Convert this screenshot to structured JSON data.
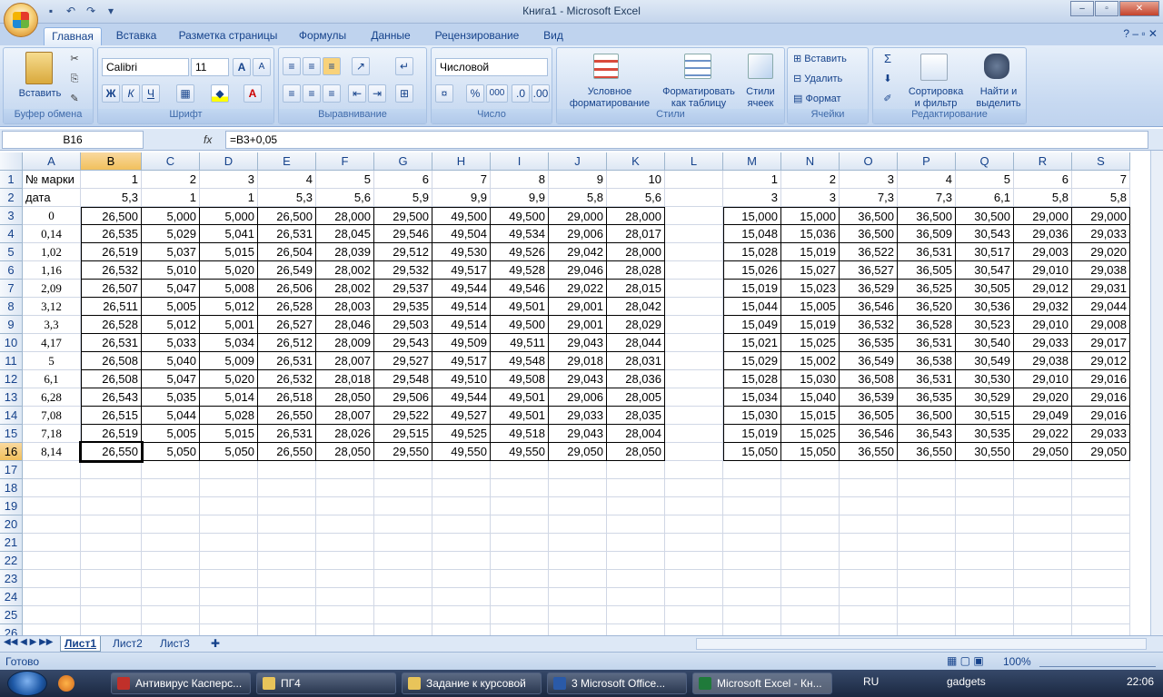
{
  "window": {
    "title": "Книга1 - Microsoft Excel",
    "btn_min": "–",
    "btn_max": "▫",
    "btn_close": "✕"
  },
  "ribbon_tabs": [
    "Главная",
    "Вставка",
    "Разметка страницы",
    "Формулы",
    "Данные",
    "Рецензирование",
    "Вид"
  ],
  "ribbon": {
    "clipboard": {
      "label": "Буфер обмена",
      "paste": "Вставить"
    },
    "font": {
      "label": "Шрифт",
      "name": "Calibri",
      "size": "11",
      "bold": "Ж",
      "italic": "К",
      "underline": "Ч"
    },
    "alignment": {
      "label": "Выравнивание"
    },
    "number": {
      "label": "Число",
      "format": "Числовой",
      "percent": "%",
      "thousands": "000"
    },
    "styles": {
      "label": "Стили",
      "cond1": "Условное",
      "cond2": "форматирование",
      "table1": "Форматировать",
      "table2": "как таблицу",
      "cell1": "Стили",
      "cell2": "ячеек"
    },
    "cells": {
      "label": "Ячейки",
      "insert": "Вставить",
      "delete": "Удалить",
      "format": "Формат"
    },
    "editing": {
      "label": "Редактирование",
      "sort1": "Сортировка",
      "sort2": "и фильтр",
      "find1": "Найти и",
      "find2": "выделить",
      "sigma": "Σ"
    }
  },
  "formula_bar": {
    "name_box": "B16",
    "fx": "fx",
    "formula": "=B3+0,05"
  },
  "columns": [
    "A",
    "B",
    "C",
    "D",
    "E",
    "F",
    "G",
    "H",
    "I",
    "J",
    "K",
    "L",
    "M",
    "N",
    "O",
    "P",
    "Q",
    "R",
    "S"
  ],
  "rows": [
    [
      "№ марки",
      "1",
      "2",
      "3",
      "4",
      "5",
      "6",
      "7",
      "8",
      "9",
      "10",
      "",
      "1",
      "2",
      "3",
      "4",
      "5",
      "6",
      "7"
    ],
    [
      "дата",
      "5,3",
      "1",
      "1",
      "5,3",
      "5,6",
      "5,9",
      "9,9",
      "9,9",
      "5,8",
      "5,6",
      "",
      "3",
      "3",
      "7,3",
      "7,3",
      "6,1",
      "5,8",
      "5,8"
    ],
    [
      "0",
      "26,500",
      "5,000",
      "5,000",
      "26,500",
      "28,000",
      "29,500",
      "49,500",
      "49,500",
      "29,000",
      "28,000",
      "",
      "15,000",
      "15,000",
      "36,500",
      "36,500",
      "30,500",
      "29,000",
      "29,000"
    ],
    [
      "0,14",
      "26,535",
      "5,029",
      "5,041",
      "26,531",
      "28,045",
      "29,546",
      "49,504",
      "49,534",
      "29,006",
      "28,017",
      "",
      "15,048",
      "15,036",
      "36,500",
      "36,509",
      "30,543",
      "29,036",
      "29,033"
    ],
    [
      "1,02",
      "26,519",
      "5,037",
      "5,015",
      "26,504",
      "28,039",
      "29,512",
      "49,530",
      "49,526",
      "29,042",
      "28,000",
      "",
      "15,028",
      "15,019",
      "36,522",
      "36,531",
      "30,517",
      "29,003",
      "29,020"
    ],
    [
      "1,16",
      "26,532",
      "5,010",
      "5,020",
      "26,549",
      "28,002",
      "29,532",
      "49,517",
      "49,528",
      "29,046",
      "28,028",
      "",
      "15,026",
      "15,027",
      "36,527",
      "36,505",
      "30,547",
      "29,010",
      "29,038"
    ],
    [
      "2,09",
      "26,507",
      "5,047",
      "5,008",
      "26,506",
      "28,002",
      "29,537",
      "49,544",
      "49,546",
      "29,022",
      "28,015",
      "",
      "15,019",
      "15,023",
      "36,529",
      "36,525",
      "30,505",
      "29,012",
      "29,031"
    ],
    [
      "3,12",
      "26,511",
      "5,005",
      "5,012",
      "26,528",
      "28,003",
      "29,535",
      "49,514",
      "49,501",
      "29,001",
      "28,042",
      "",
      "15,044",
      "15,005",
      "36,546",
      "36,520",
      "30,536",
      "29,032",
      "29,044"
    ],
    [
      "3,3",
      "26,528",
      "5,012",
      "5,001",
      "26,527",
      "28,046",
      "29,503",
      "49,514",
      "49,500",
      "29,001",
      "28,029",
      "",
      "15,049",
      "15,019",
      "36,532",
      "36,528",
      "30,523",
      "29,010",
      "29,008"
    ],
    [
      "4,17",
      "26,531",
      "5,033",
      "5,034",
      "26,512",
      "28,009",
      "29,543",
      "49,509",
      "49,511",
      "29,043",
      "28,044",
      "",
      "15,021",
      "15,025",
      "36,535",
      "36,531",
      "30,540",
      "29,033",
      "29,017"
    ],
    [
      "5",
      "26,508",
      "5,040",
      "5,009",
      "26,531",
      "28,007",
      "29,527",
      "49,517",
      "49,548",
      "29,018",
      "28,031",
      "",
      "15,029",
      "15,002",
      "36,549",
      "36,538",
      "30,549",
      "29,038",
      "29,012"
    ],
    [
      "6,1",
      "26,508",
      "5,047",
      "5,020",
      "26,532",
      "28,018",
      "29,548",
      "49,510",
      "49,508",
      "29,043",
      "28,036",
      "",
      "15,028",
      "15,030",
      "36,508",
      "36,531",
      "30,530",
      "29,010",
      "29,016"
    ],
    [
      "6,28",
      "26,543",
      "5,035",
      "5,014",
      "26,518",
      "28,050",
      "29,506",
      "49,544",
      "49,501",
      "29,006",
      "28,005",
      "",
      "15,034",
      "15,040",
      "36,539",
      "36,535",
      "30,529",
      "29,020",
      "29,016"
    ],
    [
      "7,08",
      "26,515",
      "5,044",
      "5,028",
      "26,550",
      "28,007",
      "29,522",
      "49,527",
      "49,501",
      "29,033",
      "28,035",
      "",
      "15,030",
      "15,015",
      "36,505",
      "36,500",
      "30,515",
      "29,049",
      "29,016"
    ],
    [
      "7,18",
      "26,519",
      "5,005",
      "5,015",
      "26,531",
      "28,026",
      "29,515",
      "49,525",
      "49,518",
      "29,043",
      "28,004",
      "",
      "15,019",
      "15,025",
      "36,546",
      "36,543",
      "30,535",
      "29,022",
      "29,033"
    ],
    [
      "8,14",
      "26,550",
      "5,050",
      "5,050",
      "26,550",
      "28,050",
      "29,550",
      "49,550",
      "49,550",
      "29,050",
      "28,050",
      "",
      "15,050",
      "15,050",
      "36,550",
      "36,550",
      "30,550",
      "29,050",
      "29,050"
    ]
  ],
  "empty_rows": [
    "17",
    "18",
    "19",
    "20",
    "21",
    "22",
    "23",
    "24",
    "25",
    "26"
  ],
  "sheets": [
    "Лист1",
    "Лист2",
    "Лист3"
  ],
  "status": {
    "ready": "Готово",
    "zoom": "100%"
  },
  "taskbar": {
    "items": [
      "Антивирус Касперс...",
      "ПГ4",
      "Задание к курсовой",
      "3 Microsoft Office...",
      "Microsoft Excel - Кн..."
    ],
    "lang": "RU",
    "gadgets": "gadgets",
    "time": "22:06"
  }
}
